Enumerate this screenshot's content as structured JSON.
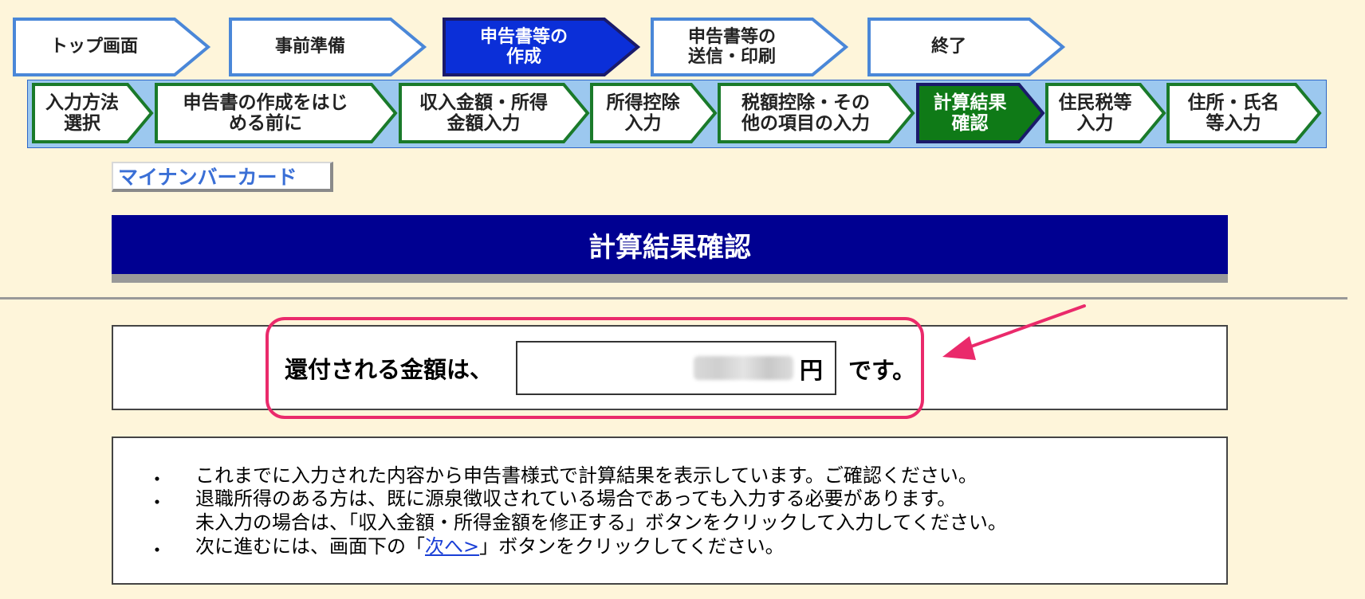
{
  "top_steps": [
    {
      "label": "トップ画面",
      "active": false
    },
    {
      "label": "事前準備",
      "active": false
    },
    {
      "label": "申告書等の\n作成",
      "active": true
    },
    {
      "label": "申告書等の\n送信・印刷",
      "active": false
    },
    {
      "label": "終了",
      "active": false
    }
  ],
  "sub_steps": [
    {
      "label": "入力方法\n選択",
      "active": false
    },
    {
      "label": "申告書の作成をはじ\nめる前に",
      "active": false
    },
    {
      "label": "収入金額・所得\n金額入力",
      "active": false
    },
    {
      "label": "所得控除\n入力",
      "active": false
    },
    {
      "label": "税額控除・その\n他の項目の入力",
      "active": false
    },
    {
      "label": "計算結果\n確認",
      "active": true
    },
    {
      "label": "住民税等\n入力",
      "active": false
    },
    {
      "label": "住所・氏名\n等入力",
      "active": false
    }
  ],
  "mynumber_button": "マイナンバーカード",
  "page_title": "計算結果確認",
  "refund": {
    "label": "還付される金額は、",
    "value": "",
    "unit": "円",
    "suffix": "です。"
  },
  "notes": {
    "bullet": "・",
    "line1": "これまでに入力された内容から申告書様式で計算結果を表示しています。ご確認ください。",
    "line2": "退職所得のある方は、既に源泉徴収されている場合であっても入力する必要があります。",
    "line3": "未入力の場合は、「収入金額・所得金額を修正する」ボタンをクリックして入力してください。",
    "line4_before": "次に進むには、画面下の「",
    "line4_link": "次へ>",
    "line4_after": "」ボタンをクリックしてください。"
  },
  "colors": {
    "page_bg": "#fef5da",
    "title_bar": "#000091",
    "top_step_border": "#4a87d8",
    "top_step_active": "#0b2fd8",
    "sub_step_border": "#1a7a2a",
    "sub_step_active": "#0f7a17",
    "sub_strip": "#9cc8ef",
    "highlight": "#ea2a6b",
    "link": "#1a3fd6"
  }
}
